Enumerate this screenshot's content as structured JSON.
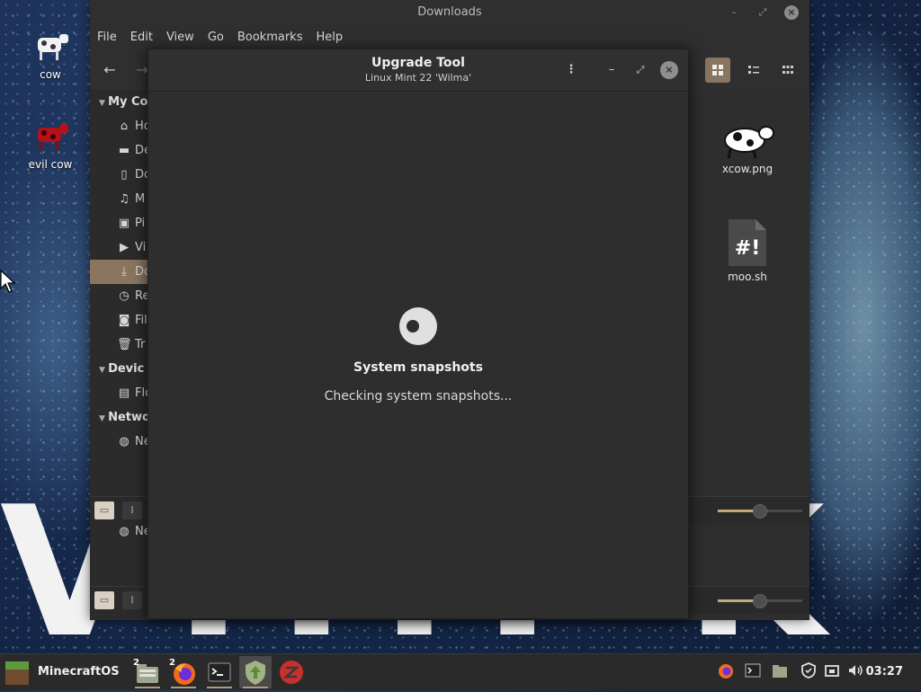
{
  "desktop": {
    "icons": [
      {
        "label": "cow"
      },
      {
        "label": "evil cow"
      }
    ],
    "wallpaper_text": "VIIII  K"
  },
  "files_window": {
    "title": "Downloads",
    "menu": [
      "File",
      "Edit",
      "View",
      "Go",
      "Bookmarks",
      "Help"
    ],
    "sidebar": {
      "sections": [
        {
          "label": "My Co",
          "items": [
            {
              "icon": "home-icon",
              "label": "Ho"
            },
            {
              "icon": "desktop-icon",
              "label": "De"
            },
            {
              "icon": "document-icon",
              "label": "Do"
            },
            {
              "icon": "music-icon",
              "label": "M"
            },
            {
              "icon": "pictures-icon",
              "label": "Pi"
            },
            {
              "icon": "video-icon",
              "label": "Vi"
            },
            {
              "icon": "download-icon",
              "label": "Do",
              "active": true
            },
            {
              "icon": "recent-icon",
              "label": "Re"
            },
            {
              "icon": "filesystem-icon",
              "label": "Fil"
            },
            {
              "icon": "trash-icon",
              "label": "Tr"
            }
          ]
        },
        {
          "label": "Devic",
          "items": [
            {
              "icon": "drive-icon",
              "label": "Flo"
            }
          ]
        },
        {
          "label": "Netwo",
          "items": [
            {
              "icon": "network-icon",
              "label": "Ne"
            }
          ]
        }
      ],
      "lower_item": {
        "icon": "network-icon",
        "label": "Ne"
      }
    },
    "files": [
      {
        "name": "xcow.png",
        "icon": "cow-image-icon"
      },
      {
        "name": "moo.sh",
        "icon": "script-icon",
        "glyph": "#!"
      }
    ]
  },
  "dialog": {
    "title": "Upgrade Tool",
    "subtitle": "Linux Mint 22 'Wilma'",
    "heading": "System snapshots",
    "status": "Checking system snapshots..."
  },
  "taskbar": {
    "menu_label": "MinecraftOS",
    "tasks": [
      {
        "name": "files",
        "badge": "2"
      },
      {
        "name": "firefox",
        "badge": "2"
      },
      {
        "name": "terminal"
      },
      {
        "name": "upgrade-tool",
        "active": true
      },
      {
        "name": "mintupdate"
      }
    ],
    "clock": "03:27"
  },
  "colors": {
    "accent": "#8a7560",
    "slider_fill": "#c5a878",
    "dialog_bg": "#2e2e2e",
    "taskbar_bg": "#2a2a2a"
  }
}
